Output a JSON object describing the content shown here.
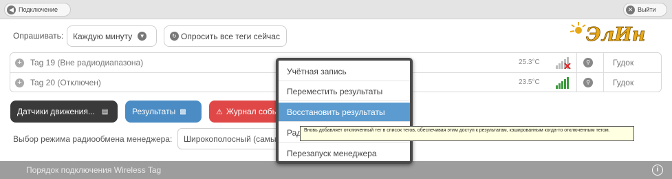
{
  "topbar": {
    "left_button": "Подключение",
    "right_button": "Выйти"
  },
  "poll": {
    "label": "Опрашивать:",
    "interval_value": "Каждую минуту",
    "poll_all_button": "Опросить все теги сейчас"
  },
  "logo": {
    "text": "ЭлИн"
  },
  "tags": [
    {
      "name": "Tag 19 (Вне радиодиапазона)",
      "temp": "25.3°C",
      "action": "Гудок",
      "signal_color": "#bbbbbb",
      "alert": true
    },
    {
      "name": "Tag 20 (Отключен)",
      "temp": "23.5°C",
      "action": "Гудок",
      "signal_color": "#3c9a3c",
      "alert": false
    }
  ],
  "buttons": {
    "motion": "Датчики движения...",
    "results": "Результаты",
    "log": "Журнал событий"
  },
  "radio_mode": {
    "label": "Выбор режима радиообмена менеджера:",
    "value": "Широкополосный (самый"
  },
  "footer": {
    "text": "Порядок подключения Wireless Tag"
  },
  "menu": {
    "items": [
      {
        "label": "Учётная запись",
        "selected": false
      },
      {
        "label": "Переместить результаты",
        "selected": false
      },
      {
        "label": "Восстановить результаты",
        "selected": true
      },
      {
        "label": "Рад",
        "selected": false
      },
      {
        "label": "Перезапуск менеджера",
        "selected": false
      }
    ]
  },
  "tooltip": {
    "text": "Вновь добавляет отключенный тег в список тегов, обеспечивая этим доступ к результатам, кэшированным когда-то отключенным тегом."
  },
  "colors": {
    "motion_button": "#3a3a3a",
    "results_button": "#4b8cc4",
    "log_button": "#e04848",
    "menu_selected": "#5b9bd0",
    "footer": "#9d9d9d"
  }
}
